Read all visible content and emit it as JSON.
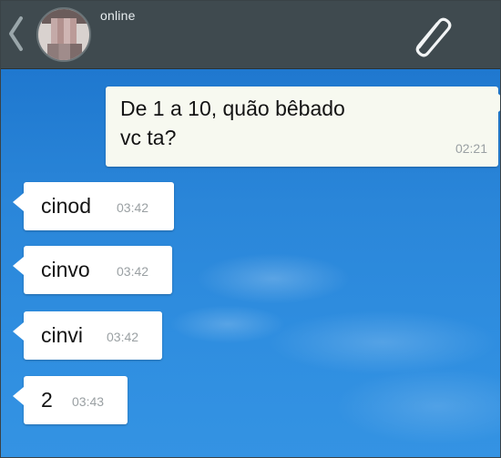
{
  "header": {
    "status": "online",
    "back_icon": "chevron-left-icon",
    "attach_icon": "paperclip-icon",
    "background_color": "#3f4a4f"
  },
  "chat": {
    "wallpaper": "blue-sky",
    "messages": [
      {
        "direction": "outgoing",
        "text_line1": "De 1 a 10, quão bêbado",
        "text_line2": "vc ta?",
        "time": "02:21"
      },
      {
        "direction": "incoming",
        "text": "cinod",
        "time": "03:42"
      },
      {
        "direction": "incoming",
        "text": "cinvo",
        "time": "03:42"
      },
      {
        "direction": "incoming",
        "text": "cinvi",
        "time": "03:42"
      },
      {
        "direction": "incoming",
        "text": "2",
        "time": "03:43"
      }
    ]
  }
}
